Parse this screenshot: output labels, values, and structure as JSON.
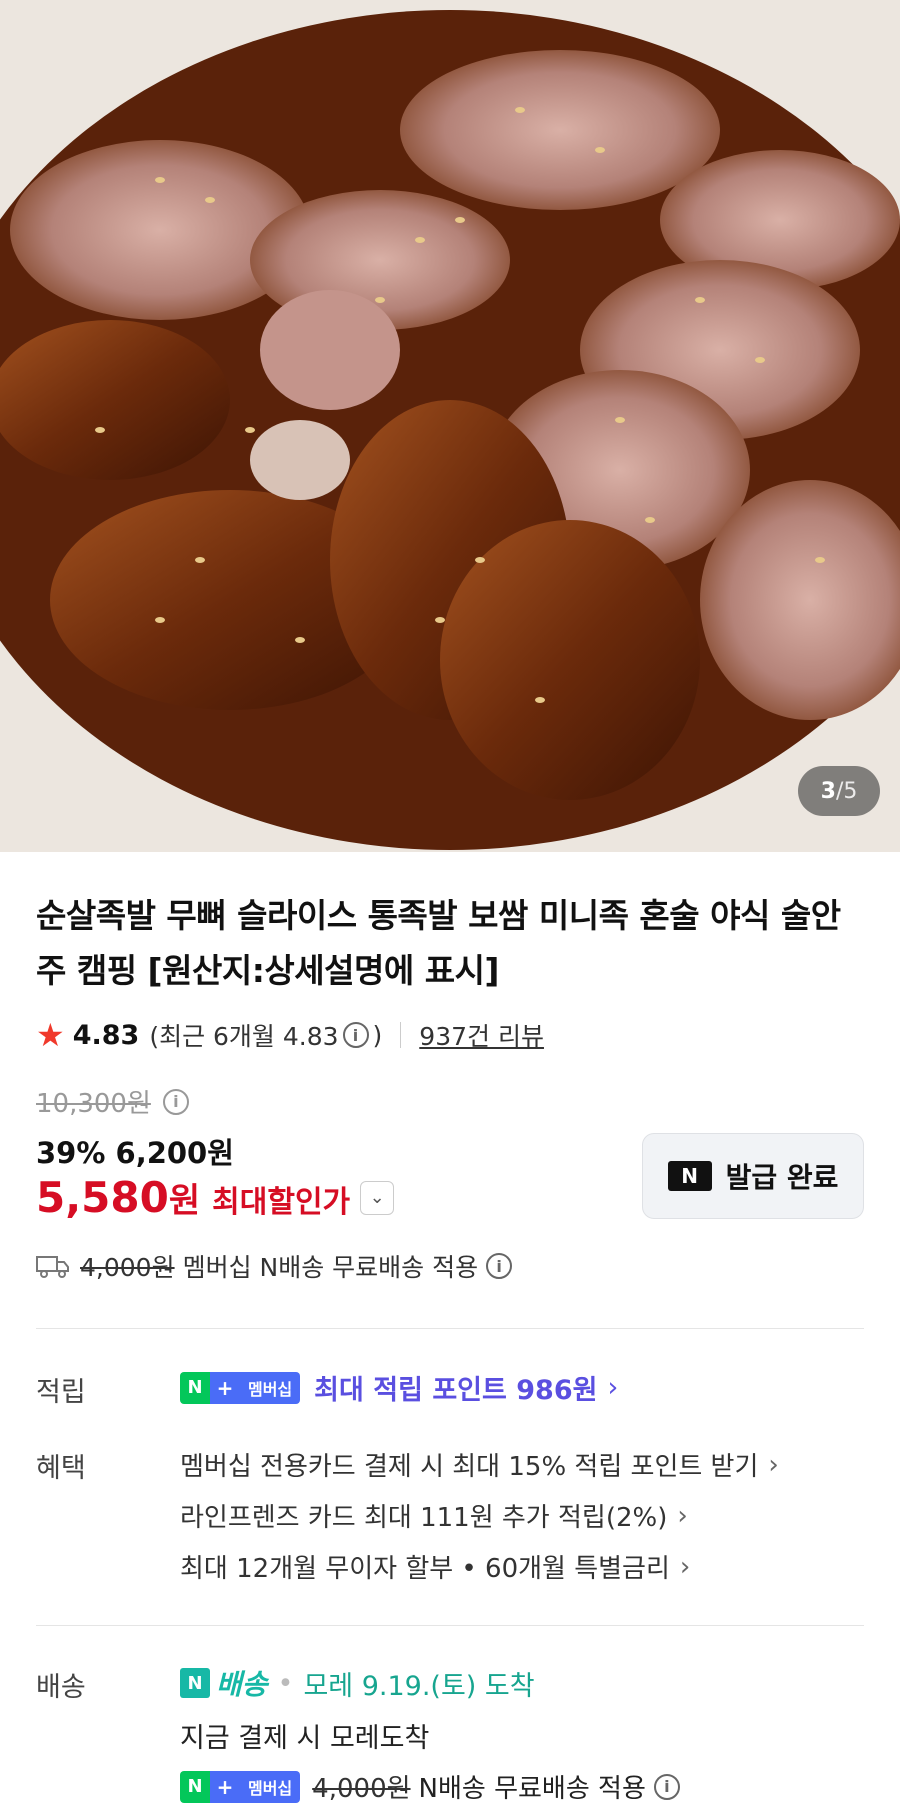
{
  "gallery": {
    "current": "3",
    "separator": "/",
    "total": "5"
  },
  "product": {
    "title": "순살족발 무뼈 슬라이스 통족발 보쌈 미니족 혼술 야식 술안주 캠핑 [원산지:상세설명에 표시]"
  },
  "rating": {
    "score": "4.83",
    "recent_prefix": "(최근 6개월 4.83",
    "recent_suffix": ")",
    "reviews": "937건 리뷰"
  },
  "price": {
    "original": "10,300원",
    "discount_line": "39% 6,200원",
    "final_amount": "5,580",
    "final_unit": "원",
    "final_label": "최대할인가"
  },
  "coupon_button": {
    "badge": "N",
    "label": "발급 완료"
  },
  "shipping": {
    "strike": "4,000원",
    "text": "멤버십 N배송 무료배송 적용"
  },
  "accrual": {
    "label": "적립",
    "badge": {
      "n": "N",
      "plus": "+",
      "text": "멤버십"
    },
    "text": "최대 적립 포인트 986원"
  },
  "benefits": {
    "label": "혜택",
    "items": [
      "멤버십 전용카드 결제 시 최대 15% 적립 포인트 받기",
      "라인프렌즈 카드 최대 111원 추가 적립(2%)",
      "최대 12개월 무이자 할부 • 60개월 특별금리"
    ]
  },
  "delivery": {
    "label": "배송",
    "ndelivery_box": "N",
    "ndelivery_text": "배송",
    "arrival": "모레 9.19.(토) 도착",
    "note": "지금 결제 시 모레도착",
    "strike": "4,000원",
    "free_text": "N배송 무료배송 적용"
  },
  "colors": {
    "sale_red": "#d60d24",
    "star": "#f0392b",
    "member_purple": "#5a4fe0",
    "ndelivery_teal": "#17b8a6"
  }
}
